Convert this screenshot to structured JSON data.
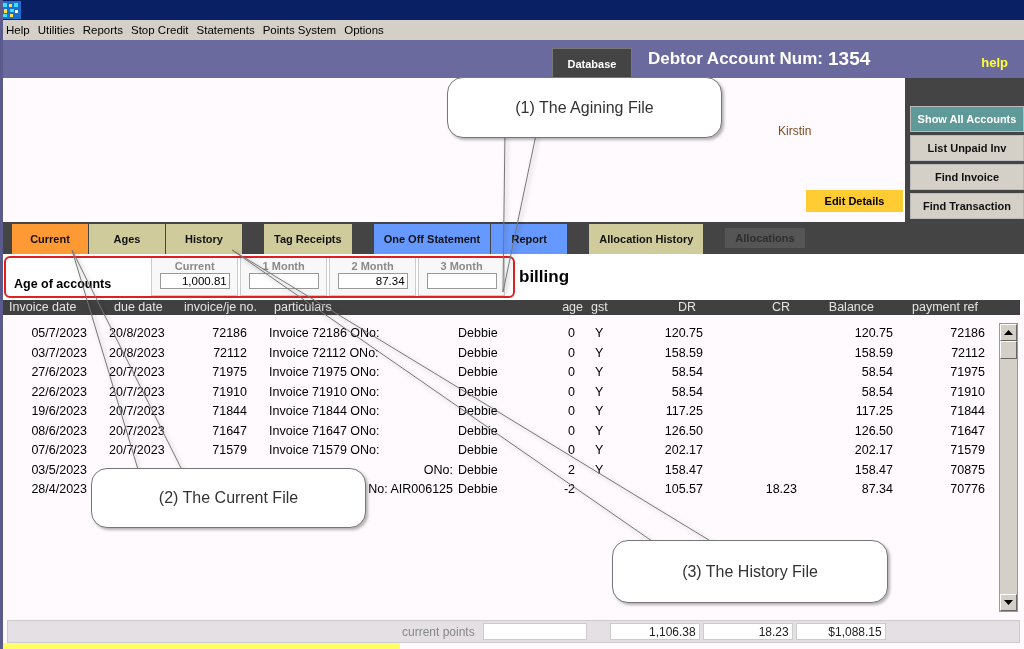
{
  "menu": [
    "Help",
    "Utilities",
    "Reports",
    "Stop Credit",
    "Statements",
    "Points System",
    "Options"
  ],
  "header": {
    "database_tab": "Database",
    "account_label": "Debtor Account Num:",
    "account_number": "1354",
    "help_link": "help"
  },
  "contact": {
    "name": "Kirstin",
    "edit_button": "Edit Details"
  },
  "side_buttons": [
    {
      "label": "Show All Accounts",
      "selected": true
    },
    {
      "label": "List Unpaid Inv",
      "selected": false
    },
    {
      "label": "Find Invoice",
      "selected": false
    },
    {
      "label": "Find Transaction",
      "selected": false
    }
  ],
  "tab_groups": [
    [
      {
        "label": "Current",
        "color": "#ff9933",
        "disabled": false
      },
      {
        "label": "Ages",
        "color": "#cfcb9a",
        "disabled": false
      },
      {
        "label": "History",
        "color": "#cfcb9a",
        "disabled": false
      }
    ],
    [
      {
        "label": "Tag Receipts",
        "color": "#cfcb9a",
        "disabled": false
      }
    ],
    [
      {
        "label": "One Off Statement",
        "color": "#6699ff",
        "disabled": false
      },
      {
        "label": "Report",
        "color": "#6699ff",
        "disabled": false
      }
    ],
    [
      {
        "label": "Allocation History",
        "color": "#cfcb9a",
        "disabled": false
      }
    ],
    [
      {
        "label": "Allocations",
        "color": "#555555",
        "disabled": true
      }
    ]
  ],
  "aging": {
    "title": "Age of accounts",
    "buckets": [
      {
        "label": "Current",
        "value": "1,000.81"
      },
      {
        "label": "1 Month"
      },
      {
        "label": "2 Month",
        "value": "87.34"
      },
      {
        "label": "3 Month"
      }
    ]
  },
  "billing_label": "billing",
  "table": {
    "columns": [
      "Invoice date",
      "due date",
      "invoice/je no.",
      "particulars",
      "age",
      "gst",
      "DR",
      "CR",
      "Balance",
      "payment ref"
    ],
    "rows": [
      {
        "invoice_date": "05/7/2023",
        "due_date": "20/8/2023",
        "invoice_no": "72186",
        "particulars": "Invoice 72186 ONo:",
        "particulars_start_hidden": false,
        "name": "Debbie",
        "age": "0",
        "gst": "Y",
        "dr": "120.75",
        "balance": "120.75",
        "payment_ref": "72186"
      },
      {
        "invoice_date": "03/7/2023",
        "due_date": "20/8/2023",
        "invoice_no": "72112",
        "particulars": "Invoice 72112 ONo:",
        "particulars_start_hidden": false,
        "name": "Debbie",
        "age": "0",
        "gst": "Y",
        "dr": "158.59",
        "balance": "158.59",
        "payment_ref": "72112"
      },
      {
        "invoice_date": "27/6/2023",
        "due_date": "20/7/2023",
        "invoice_no": "71975",
        "particulars": "Invoice 71975 ONo:",
        "particulars_start_hidden": false,
        "name": "Debbie",
        "age": "0",
        "gst": "Y",
        "dr": "58.54",
        "balance": "58.54",
        "payment_ref": "71975"
      },
      {
        "invoice_date": "22/6/2023",
        "due_date": "20/7/2023",
        "invoice_no": "71910",
        "particulars": "Invoice 71910 ONo:",
        "particulars_start_hidden": false,
        "name": "Debbie",
        "age": "0",
        "gst": "Y",
        "dr": "58.54",
        "balance": "58.54",
        "payment_ref": "71910"
      },
      {
        "invoice_date": "19/6/2023",
        "due_date": "20/7/2023",
        "invoice_no": "71844",
        "particulars": "Invoice 71844 ONo:",
        "particulars_start_hidden": false,
        "name": "Debbie",
        "age": "0",
        "gst": "Y",
        "dr": "117.25",
        "balance": "117.25",
        "payment_ref": "71844"
      },
      {
        "invoice_date": "08/6/2023",
        "due_date": "20/7/2023",
        "invoice_no": "71647",
        "particulars": "Invoice 71647 ONo:",
        "particulars_start_hidden": false,
        "name": "Debbie",
        "age": "0",
        "gst": "Y",
        "dr": "126.50",
        "balance": "126.50",
        "payment_ref": "71647"
      },
      {
        "invoice_date": "07/6/2023",
        "due_date": "20/7/2023",
        "invoice_no": "71579",
        "particulars": "Invoice 71579 ONo:",
        "particulars_start_hidden": false,
        "name": "Debbie",
        "age": "0",
        "gst": "Y",
        "dr": "202.17",
        "balance": "202.17",
        "payment_ref": "71579"
      },
      {
        "invoice_date": "03/5/2023",
        "particulars": "ONo:",
        "particulars_start_hidden": true,
        "name": "Debbie",
        "age": "2",
        "gst": "Y",
        "dr": "158.47",
        "balance": "158.47",
        "payment_ref": "70875"
      },
      {
        "invoice_date": "28/4/2023",
        "particulars": "No: AIR006125",
        "particulars_start_hidden": true,
        "name": "Debbie",
        "age": "-2",
        "dr": "105.57",
        "cr": "18.23",
        "balance": "87.34",
        "payment_ref": "70776"
      }
    ]
  },
  "totals": {
    "label": "current points",
    "dr": "1,106.38",
    "cr": "18.23",
    "balance": "$1,088.15"
  },
  "callouts": [
    {
      "text": "(1) The Agining File"
    },
    {
      "text": "(2) The Current File"
    },
    {
      "text": "(3) The History File"
    }
  ]
}
